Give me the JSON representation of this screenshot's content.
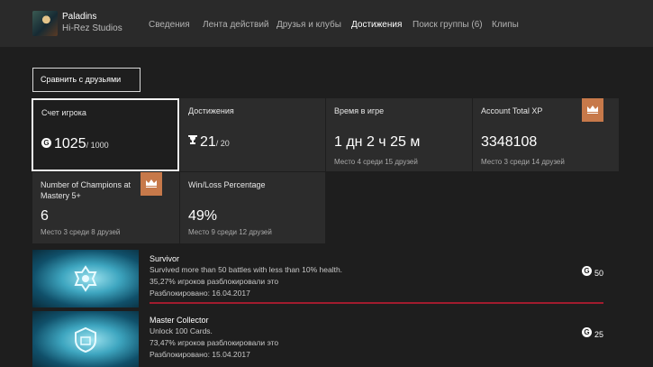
{
  "game": {
    "title": "Paladins",
    "publisher": "Hi-Rez Studios"
  },
  "nav": [
    "Сведения",
    "Лента действий",
    "Друзья и клубы",
    "Достижения",
    "Поиск группы (6)",
    "Клипы"
  ],
  "compare_button": "Сравнить с друзьями",
  "stats": {
    "gamerscore": {
      "label": "Счет игрока",
      "value": "1025",
      "total": "/ 1000"
    },
    "achievements": {
      "label": "Достижения",
      "value": "21",
      "total": "/ 20"
    },
    "playtime": {
      "label": "Время в игре",
      "value": "1 дн 2 ч 25 м",
      "rank": "Место 4 среди 15 друзей"
    },
    "xp": {
      "label": "Account Total XP",
      "value": "3348108",
      "rank": "Место 3 среди 14 друзей"
    },
    "champions": {
      "label": "Number of Champions at Mastery 5+",
      "value": "6",
      "rank": "Место 3 среди 8 друзей"
    },
    "winloss": {
      "label": "Win/Loss Percentage",
      "value": "49%",
      "rank": "Место 9 среди 12 друзей"
    }
  },
  "achievements": [
    {
      "title": "Survivor",
      "description": "Survived more than 50 battles with less than 10% health.",
      "percent": "35,27% игроков разблокировали это",
      "unlocked": "Разблокировано: 16.04.2017",
      "score": "50"
    },
    {
      "title": "Master Collector",
      "description": "Unlock 100 Cards.",
      "percent": "73,47% игроков разблокировали это",
      "unlocked": "Разблокировано: 15.04.2017",
      "score": "25"
    }
  ],
  "icons": {
    "gamerscore": "gamerscore-icon",
    "trophy": "trophy-icon",
    "crown": "crown-icon"
  },
  "colors": {
    "accent_ribbon": "#c7794a",
    "achievement_bar": "#a11c2e"
  }
}
